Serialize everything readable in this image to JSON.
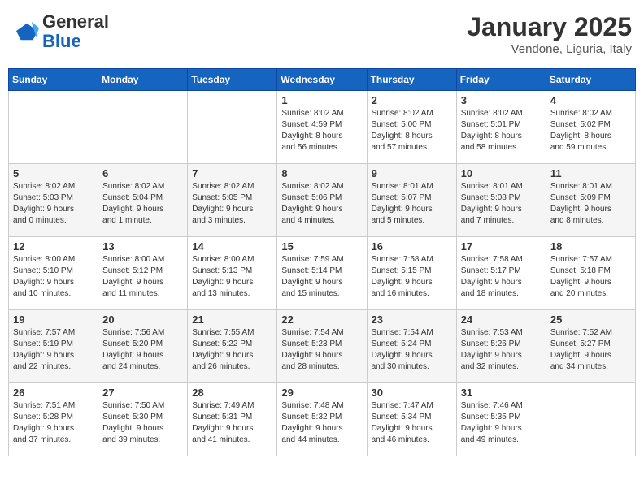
{
  "header": {
    "logo_general": "General",
    "logo_blue": "Blue",
    "month_title": "January 2025",
    "subtitle": "Vendone, Liguria, Italy"
  },
  "days_of_week": [
    "Sunday",
    "Monday",
    "Tuesday",
    "Wednesday",
    "Thursday",
    "Friday",
    "Saturday"
  ],
  "weeks": [
    [
      {
        "day": "",
        "info": ""
      },
      {
        "day": "",
        "info": ""
      },
      {
        "day": "",
        "info": ""
      },
      {
        "day": "1",
        "info": "Sunrise: 8:02 AM\nSunset: 4:59 PM\nDaylight: 8 hours\nand 56 minutes."
      },
      {
        "day": "2",
        "info": "Sunrise: 8:02 AM\nSunset: 5:00 PM\nDaylight: 8 hours\nand 57 minutes."
      },
      {
        "day": "3",
        "info": "Sunrise: 8:02 AM\nSunset: 5:01 PM\nDaylight: 8 hours\nand 58 minutes."
      },
      {
        "day": "4",
        "info": "Sunrise: 8:02 AM\nSunset: 5:02 PM\nDaylight: 8 hours\nand 59 minutes."
      }
    ],
    [
      {
        "day": "5",
        "info": "Sunrise: 8:02 AM\nSunset: 5:03 PM\nDaylight: 9 hours\nand 0 minutes."
      },
      {
        "day": "6",
        "info": "Sunrise: 8:02 AM\nSunset: 5:04 PM\nDaylight: 9 hours\nand 1 minute."
      },
      {
        "day": "7",
        "info": "Sunrise: 8:02 AM\nSunset: 5:05 PM\nDaylight: 9 hours\nand 3 minutes."
      },
      {
        "day": "8",
        "info": "Sunrise: 8:02 AM\nSunset: 5:06 PM\nDaylight: 9 hours\nand 4 minutes."
      },
      {
        "day": "9",
        "info": "Sunrise: 8:01 AM\nSunset: 5:07 PM\nDaylight: 9 hours\nand 5 minutes."
      },
      {
        "day": "10",
        "info": "Sunrise: 8:01 AM\nSunset: 5:08 PM\nDaylight: 9 hours\nand 7 minutes."
      },
      {
        "day": "11",
        "info": "Sunrise: 8:01 AM\nSunset: 5:09 PM\nDaylight: 9 hours\nand 8 minutes."
      }
    ],
    [
      {
        "day": "12",
        "info": "Sunrise: 8:00 AM\nSunset: 5:10 PM\nDaylight: 9 hours\nand 10 minutes."
      },
      {
        "day": "13",
        "info": "Sunrise: 8:00 AM\nSunset: 5:12 PM\nDaylight: 9 hours\nand 11 minutes."
      },
      {
        "day": "14",
        "info": "Sunrise: 8:00 AM\nSunset: 5:13 PM\nDaylight: 9 hours\nand 13 minutes."
      },
      {
        "day": "15",
        "info": "Sunrise: 7:59 AM\nSunset: 5:14 PM\nDaylight: 9 hours\nand 15 minutes."
      },
      {
        "day": "16",
        "info": "Sunrise: 7:58 AM\nSunset: 5:15 PM\nDaylight: 9 hours\nand 16 minutes."
      },
      {
        "day": "17",
        "info": "Sunrise: 7:58 AM\nSunset: 5:17 PM\nDaylight: 9 hours\nand 18 minutes."
      },
      {
        "day": "18",
        "info": "Sunrise: 7:57 AM\nSunset: 5:18 PM\nDaylight: 9 hours\nand 20 minutes."
      }
    ],
    [
      {
        "day": "19",
        "info": "Sunrise: 7:57 AM\nSunset: 5:19 PM\nDaylight: 9 hours\nand 22 minutes."
      },
      {
        "day": "20",
        "info": "Sunrise: 7:56 AM\nSunset: 5:20 PM\nDaylight: 9 hours\nand 24 minutes."
      },
      {
        "day": "21",
        "info": "Sunrise: 7:55 AM\nSunset: 5:22 PM\nDaylight: 9 hours\nand 26 minutes."
      },
      {
        "day": "22",
        "info": "Sunrise: 7:54 AM\nSunset: 5:23 PM\nDaylight: 9 hours\nand 28 minutes."
      },
      {
        "day": "23",
        "info": "Sunrise: 7:54 AM\nSunset: 5:24 PM\nDaylight: 9 hours\nand 30 minutes."
      },
      {
        "day": "24",
        "info": "Sunrise: 7:53 AM\nSunset: 5:26 PM\nDaylight: 9 hours\nand 32 minutes."
      },
      {
        "day": "25",
        "info": "Sunrise: 7:52 AM\nSunset: 5:27 PM\nDaylight: 9 hours\nand 34 minutes."
      }
    ],
    [
      {
        "day": "26",
        "info": "Sunrise: 7:51 AM\nSunset: 5:28 PM\nDaylight: 9 hours\nand 37 minutes."
      },
      {
        "day": "27",
        "info": "Sunrise: 7:50 AM\nSunset: 5:30 PM\nDaylight: 9 hours\nand 39 minutes."
      },
      {
        "day": "28",
        "info": "Sunrise: 7:49 AM\nSunset: 5:31 PM\nDaylight: 9 hours\nand 41 minutes."
      },
      {
        "day": "29",
        "info": "Sunrise: 7:48 AM\nSunset: 5:32 PM\nDaylight: 9 hours\nand 44 minutes."
      },
      {
        "day": "30",
        "info": "Sunrise: 7:47 AM\nSunset: 5:34 PM\nDaylight: 9 hours\nand 46 minutes."
      },
      {
        "day": "31",
        "info": "Sunrise: 7:46 AM\nSunset: 5:35 PM\nDaylight: 9 hours\nand 49 minutes."
      },
      {
        "day": "",
        "info": ""
      }
    ]
  ]
}
